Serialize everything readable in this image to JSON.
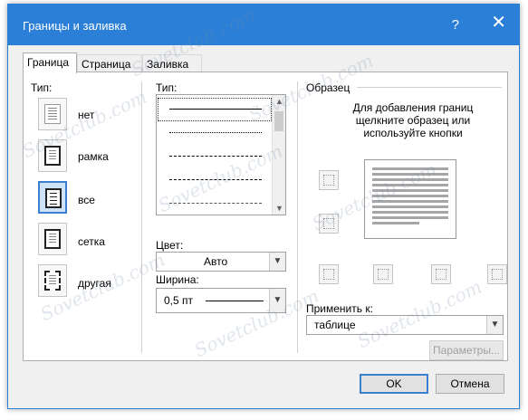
{
  "window": {
    "title": "Границы и заливка",
    "help": "?",
    "close": "✕"
  },
  "tabs": [
    {
      "label": "Граница"
    },
    {
      "label": "Страница"
    },
    {
      "label": "Заливка"
    }
  ],
  "type_section": {
    "label": "Тип:",
    "options": [
      {
        "label": "нет"
      },
      {
        "label": "рамка"
      },
      {
        "label": "все"
      },
      {
        "label": "сетка"
      },
      {
        "label": "другая"
      }
    ],
    "selected": "все"
  },
  "style_section": {
    "label": "Тип:",
    "color_label": "Цвет:",
    "color_value": "Авто",
    "width_label": "Ширина:",
    "width_value": "0,5 пт"
  },
  "preview_section": {
    "label": "Образец",
    "hint_line1": "Для добавления границ",
    "hint_line2": "щелкните образец или",
    "hint_line3": "используйте кнопки",
    "apply_label": "Применить к:",
    "apply_value": "таблице",
    "params_button": "Параметры..."
  },
  "footer": {
    "ok": "OK",
    "cancel": "Отмена"
  },
  "watermark": "Sovetclub.com"
}
